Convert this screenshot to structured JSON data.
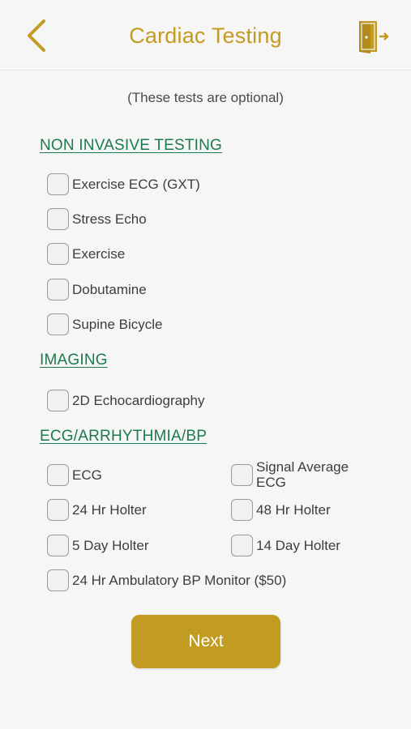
{
  "header": {
    "title": "Cardiac Testing",
    "accent_color": "#c39b22"
  },
  "subtitle": "(These tests are optional)",
  "sections": {
    "non_invasive": {
      "heading": "NON INVASIVE TESTING",
      "items": [
        "Exercise ECG (GXT)",
        "Stress Echo",
        "Exercise",
        "Dobutamine",
        "Supine Bicycle"
      ]
    },
    "imaging": {
      "heading": "IMAGING",
      "items": [
        "2D Echocardiography"
      ]
    },
    "ecg": {
      "heading": "ECG/ARRHYTHMIA/BP",
      "items": [
        "ECG",
        "Signal Average ECG",
        "24 Hr Holter",
        "48 Hr Holter",
        "5 Day Holter",
        "14 Day Holter",
        "24 Hr Ambulatory BP Monitor ($50)"
      ]
    }
  },
  "heading_color": "#1b7b4b",
  "next_button": {
    "label": "Next"
  },
  "checked_state": "all-unchecked"
}
